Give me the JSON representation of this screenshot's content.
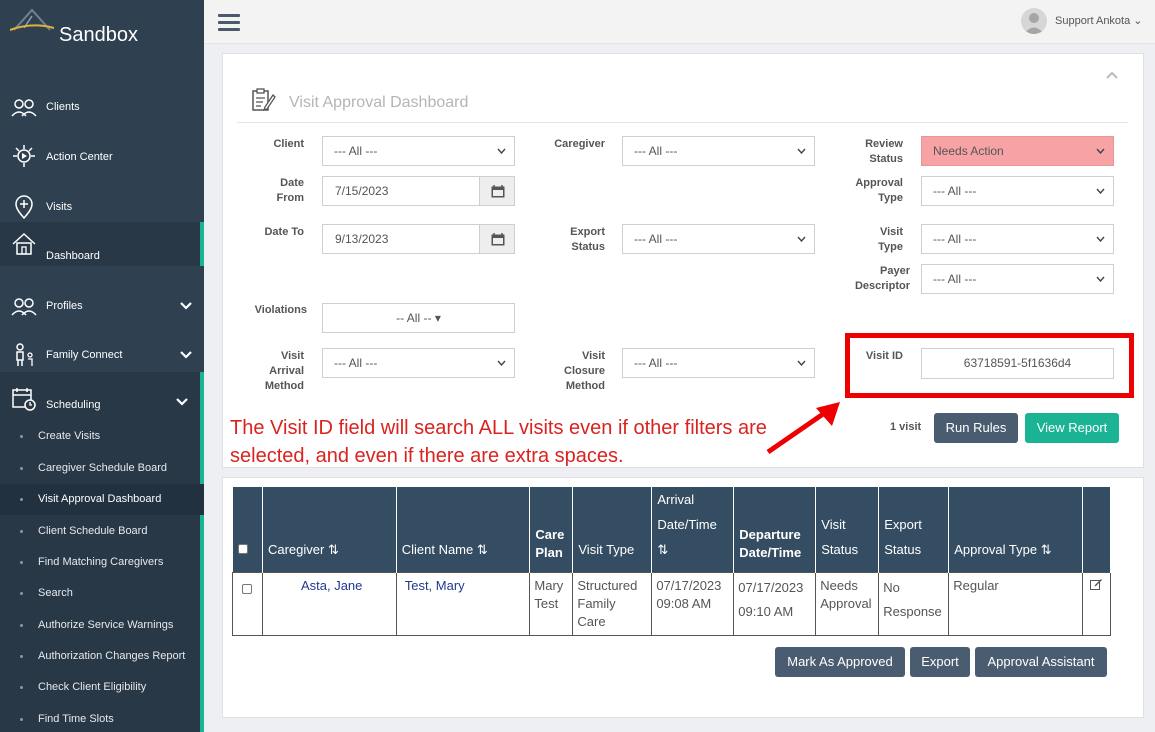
{
  "app": {
    "brand": "Sandbox"
  },
  "sidebar": {
    "items": [
      {
        "label": "Clients",
        "icon": "clients-icon"
      },
      {
        "label": "Action Center",
        "icon": "action-center-icon"
      },
      {
        "label": "Visits",
        "icon": "visits-icon"
      },
      {
        "label": "Dashboard",
        "icon": "dashboard-icon"
      },
      {
        "label": "Profiles",
        "icon": "profiles-icon"
      },
      {
        "label": "Family Connect",
        "icon": "family-connect-icon"
      },
      {
        "label": "Scheduling",
        "icon": "scheduling-icon"
      }
    ],
    "sub_items": [
      "Create Visits",
      "Caregiver Schedule Board",
      "Visit Approval Dashboard",
      "Client Schedule Board",
      "Find Matching Caregivers",
      "Search",
      "Authorize Service Warnings",
      "Authorization Changes Report",
      "Check Client Eligibility",
      "Find Time Slots"
    ]
  },
  "header": {
    "user": "Support Ankota"
  },
  "page": {
    "title": "Visit Approval Dashboard"
  },
  "filters": {
    "client": {
      "label": "Client",
      "value": "--- All ---"
    },
    "caregiver": {
      "label": "Caregiver",
      "value": "--- All ---"
    },
    "review_status": {
      "label": "Review Status",
      "value": "Needs Action"
    },
    "date_from": {
      "label": "Date From",
      "value": "7/15/2023"
    },
    "approval_type": {
      "label": "Approval Type",
      "value": "--- All ---"
    },
    "date_to": {
      "label": "Date To",
      "value": "9/13/2023"
    },
    "export_status": {
      "label": "Export Status",
      "value": "--- All ---"
    },
    "visit_type": {
      "label": "Visit Type",
      "value": "--- All ---"
    },
    "payer_descriptor": {
      "label": "Payer Descriptor",
      "value": "--- All ---"
    },
    "violations": {
      "label": "Violations",
      "value": "-- All --"
    },
    "arrival_method": {
      "label": "Visit Arrival Method",
      "value": "--- All ---"
    },
    "closure_method": {
      "label": "Visit Closure Method",
      "value": "--- All ---"
    },
    "visit_id": {
      "label": "Visit ID",
      "value": "63718591-5f1636d4"
    }
  },
  "annotation": {
    "text": "The Visit ID field will search ALL visits even if other filters are selected, and even if there are extra spaces.",
    "color": "#ee0000"
  },
  "actions": {
    "count": "1 visit",
    "run_rules": "Run Rules",
    "view_report": "View Report"
  },
  "table": {
    "headers": {
      "caregiver": "Caregiver",
      "client_name": "Client Name",
      "care_plan_1": "Care",
      "care_plan_2": "Plan",
      "visit_type": "Visit Type",
      "arrival_1": "Arrival",
      "arrival_2": "Date/Time",
      "departure_1": "Departure",
      "departure_2": "Date/Time",
      "visit_status_1": "Visit",
      "visit_status_2": "Status",
      "export_status_1": "Export",
      "export_status_2": "Status",
      "approval_type": "Approval Type"
    },
    "rows": [
      {
        "caregiver": "Asta, Jane",
        "client": "Test, Mary",
        "care_plan_1": "Mary",
        "care_plan_2": "Test",
        "visit_type_1": "Structured",
        "visit_type_2": "Family Care",
        "arrival_date": "07/17/2023",
        "arrival_time": "09:08 AM",
        "departure_date": "07/17/2023",
        "departure_time": "09:10 AM",
        "status_1": "Needs",
        "status_2": "Approval",
        "export_1": "No",
        "export_2": "Response",
        "approval_type": "Regular"
      }
    ]
  },
  "bottom_buttons": {
    "mark_approved": "Mark As Approved",
    "export": "Export",
    "approval_assistant": "Approval Assistant"
  }
}
